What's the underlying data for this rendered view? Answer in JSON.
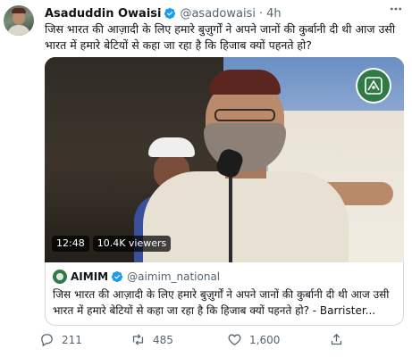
{
  "tweet": {
    "display_name": "Asaduddin Owaisi",
    "handle": "@asadowaisi",
    "separator": "·",
    "time": "4h",
    "text": "जिस भारत की आज़ादी के लिए हमारे बुज़ुर्गों ने अपने जानों की कुर्बानी दी थी आज उसी भारत में हमारे बेटियों से कहा जा रहा है कि हिजाब क्यों पहनते हो?",
    "more_icon": "more-horizontal-icon"
  },
  "media": {
    "duration": "12:48",
    "views": "10.4K viewers",
    "badge_icon": "aimim-logo-icon"
  },
  "quote": {
    "display_name": "AIMIM",
    "handle": "@aimim_national",
    "text": "जिस भारत की आज़ादी के लिए हमारे बुज़ुर्गों ने अपने जानों की कुर्बानी दी थी आज उसी भारत में हमारे बेटियों से कहा जा रहा है कि हिजाब क्यों पहनते हो? - Barrister..."
  },
  "actions": {
    "reply_count": "211",
    "retweet_count": "485",
    "like_count": "1,600"
  },
  "colors": {
    "verified": "#1d9bf0",
    "muted": "#536471",
    "text": "#0f1419",
    "border": "#cfd9de",
    "aimim_green": "#2f7a45"
  }
}
